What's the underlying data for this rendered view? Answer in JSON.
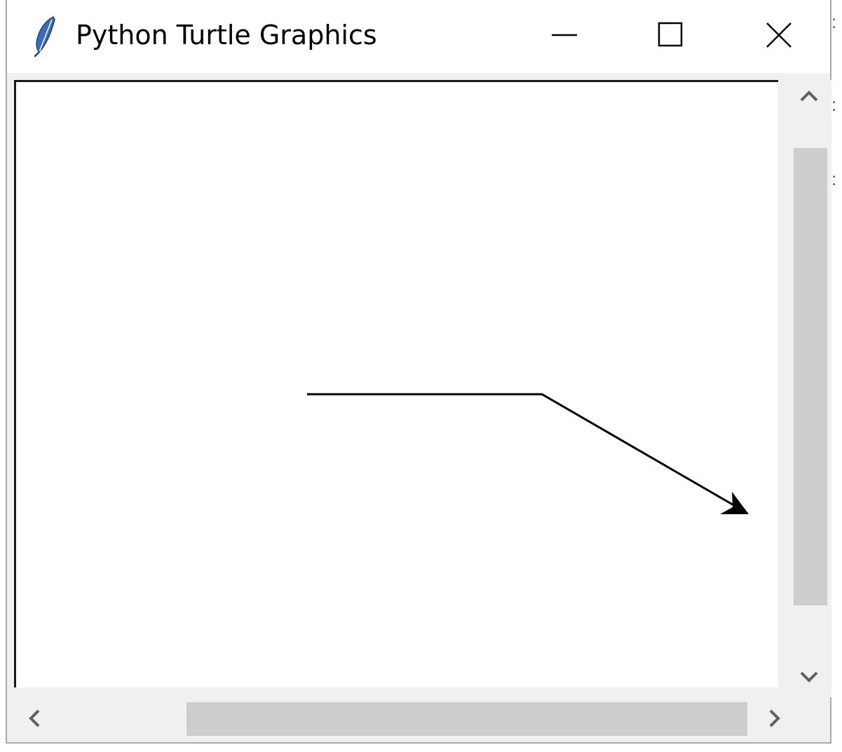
{
  "window": {
    "title": "Python Turtle Graphics",
    "icon": "feather-icon"
  },
  "title_controls": {
    "minimize": "minimize-icon",
    "maximize": "maximize-icon",
    "close": "close-icon"
  },
  "canvas": {
    "background": "#ffffff",
    "stroke_color": "#000000"
  },
  "scrollbars": {
    "up": "chevron-up-icon",
    "down": "chevron-down-icon",
    "left": "chevron-left-icon",
    "right": "chevron-right-icon"
  },
  "colors": {
    "chrome": "#f0f0f0",
    "scroll_thumb": "#cdcdcd",
    "icon_feather": "#3b6db5"
  }
}
